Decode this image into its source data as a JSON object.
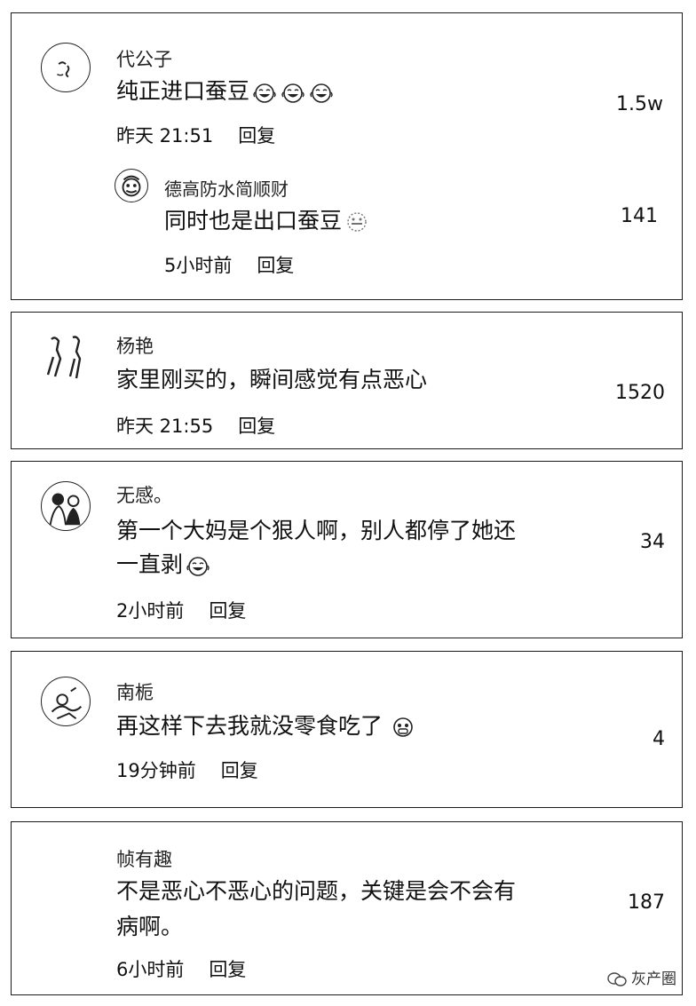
{
  "comments": [
    {
      "user": "代公子",
      "text": "纯正进口蚕豆",
      "emoji_count": 3,
      "time": "昨天 21:51",
      "reply": "回复",
      "likes": "1.5w",
      "replies": [
        {
          "user": "德高防水简顺财",
          "text": "同时也是出口蚕豆",
          "time": "5小时前",
          "reply": "回复",
          "likes": "141"
        }
      ]
    },
    {
      "user": "杨艳",
      "text": "家里刚买的，瞬间感觉有点恶心",
      "time": "昨天 21:55",
      "reply": "回复",
      "likes": "1520"
    },
    {
      "user": "无感。",
      "text_line1": "第一个大妈是个狠人啊，别人都停了她还",
      "text_line2": "一直剥",
      "time": "2小时前",
      "reply": "回复",
      "likes": "34"
    },
    {
      "user": "南栀",
      "text": "再这样下去我就没零食吃了",
      "time": "19分钟前",
      "reply": "回复",
      "likes": "4"
    },
    {
      "user": "帧有趣",
      "text_line1": "不是恶心不恶心的问题，关键是会不会有",
      "text_line2": "病啊。",
      "time": "6小时前",
      "reply": "回复",
      "likes": "187"
    }
  ],
  "watermark": "灰产圈",
  "icons": {
    "emoji": "laughing-tears-emoji-icon",
    "small_emoji": "grin-emoji-icon",
    "watermark": "wechat-icon"
  }
}
